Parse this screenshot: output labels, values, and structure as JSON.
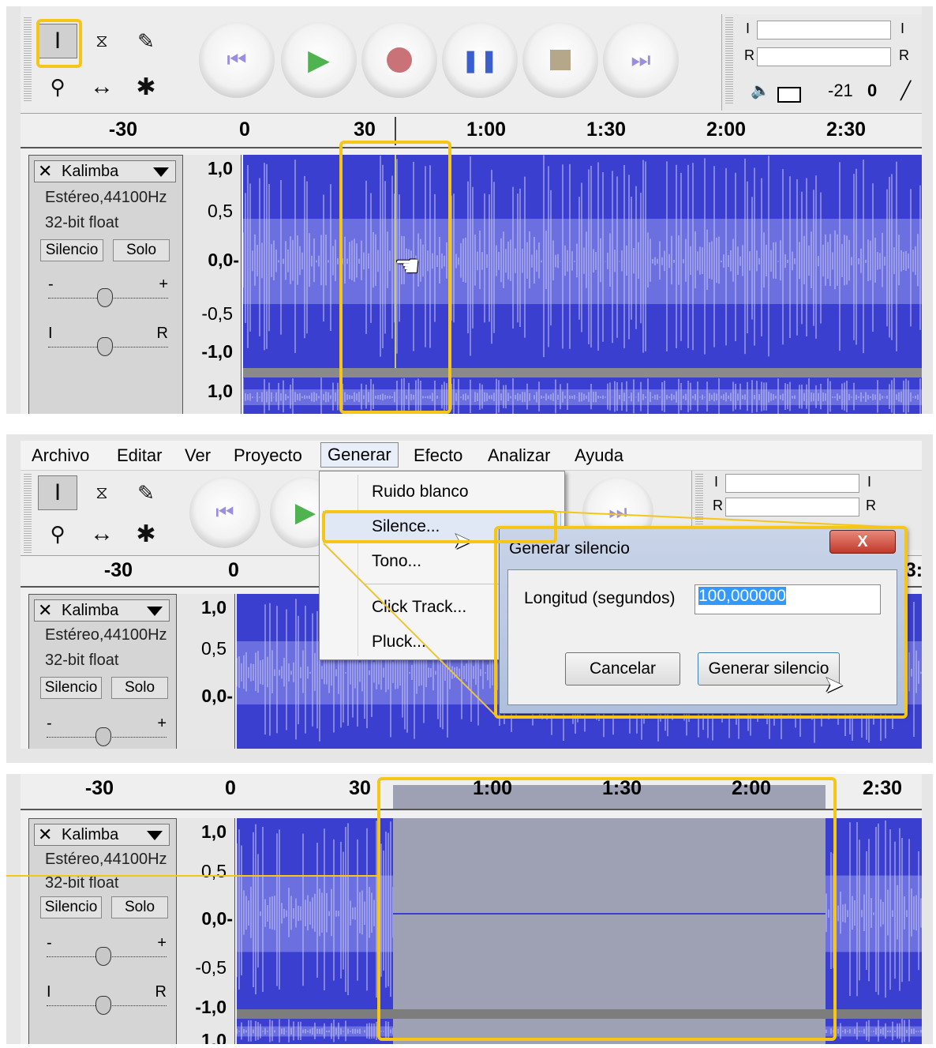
{
  "colors": {
    "highlight": "#f5c518",
    "waveform": "#3b3fcf",
    "selection": "#9ea0b3"
  },
  "tools": {
    "icons": [
      "ibeam-icon",
      "envelope-icon",
      "pencil-icon",
      "zoom-icon",
      "timeshift-icon",
      "multi-tool-icon"
    ]
  },
  "transport": {
    "icons": [
      "skip-start-icon",
      "play-icon",
      "record-icon",
      "pause-icon",
      "stop-icon",
      "skip-end-icon"
    ]
  },
  "meter": {
    "l_label": "I",
    "r_label": "R",
    "db_neg": "-21",
    "db_zero": "0"
  },
  "ruler": {
    "top": [
      "-30",
      "0",
      "30",
      "1:00",
      "1:30",
      "2:00",
      "2:30"
    ],
    "bottom_end": "2:30",
    "mid_cut": "3:"
  },
  "track": {
    "name": "Kalimba",
    "format": "Estéreo,44100Hz",
    "bits": "32-bit float",
    "mute": "Silencio",
    "solo": "Solo",
    "gain_minus": "-",
    "gain_plus": "+",
    "pan_left": "I",
    "pan_right": "R"
  },
  "vruler": {
    "v1": "1,0",
    "v05": "0,5",
    "v0": "0,0-",
    "vm05": "-0,5",
    "vm1": "-1,0",
    "v1b": "1,0",
    "cut": "-0,5",
    "cut2": "1,0"
  },
  "menu": {
    "items": [
      "Archivo",
      "Editar",
      "Ver",
      "Proyecto",
      "Generar",
      "Efecto",
      "Analizar",
      "Ayuda"
    ],
    "generar_items": [
      "Ruido blanco",
      "Silence...",
      "Tono...",
      "Click Track...",
      "Pluck..."
    ]
  },
  "dialog": {
    "title": "Generar silencio",
    "close": "X",
    "length_label": "Longitud (segundos)",
    "length_value": "100,000000",
    "cancel": "Cancelar",
    "ok": "Generar silencio"
  }
}
